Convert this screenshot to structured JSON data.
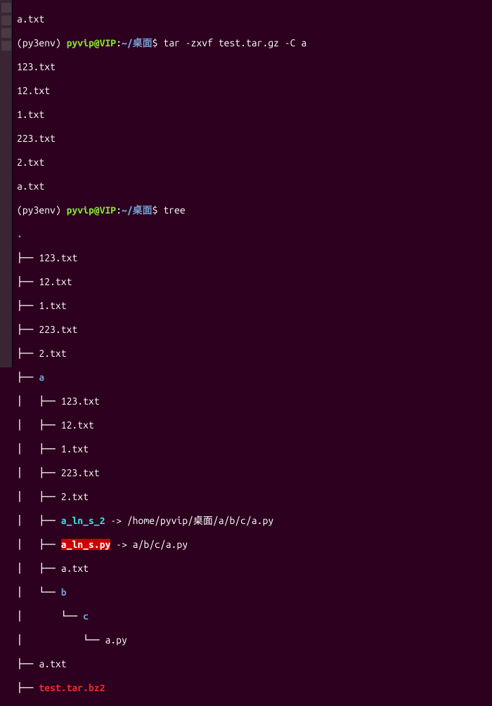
{
  "launcher": {
    "icons": [
      "icon1",
      "icon2",
      "icon3",
      "icon4"
    ]
  },
  "prompt": {
    "env": "(py3env)",
    "user": "pyvip@VIP",
    "sep": ":",
    "path": "~/桌面",
    "symbol": "$"
  },
  "top_cut": "a.txt",
  "cmd1": "tar -zxvf test.tar.gz -C a",
  "tar_output": [
    "123.txt",
    "12.txt",
    "1.txt",
    "223.txt",
    "2.txt",
    "a.txt"
  ],
  "cmd2": "tree",
  "tree": {
    "root": ".",
    "l0": {
      "f1": "123.txt",
      "f2": "12.txt",
      "f3": "1.txt",
      "f4": "223.txt",
      "f5": "2.txt",
      "dir_a": "a",
      "a_children": {
        "f1": "123.txt",
        "f2": "12.txt",
        "f3": "1.txt",
        "f4": "223.txt",
        "f5": "2.txt",
        "sym1_name": "a_ln_s_2",
        "sym1_arrow": " -> ",
        "sym1_target": "/home/pyvip/桌面/a/b/c/a.py",
        "sym2_name": "a_ln_s.py",
        "sym2_arrow": " -> ",
        "sym2_target": "a/b/c/a.py",
        "f6": "a.txt",
        "dir_b": "b",
        "b_children": {
          "dir_c": "c",
          "c_children": {
            "f1": "a.py"
          }
        }
      },
      "f6": "a.txt",
      "archive": "test.tar.bz2"
    }
  }
}
